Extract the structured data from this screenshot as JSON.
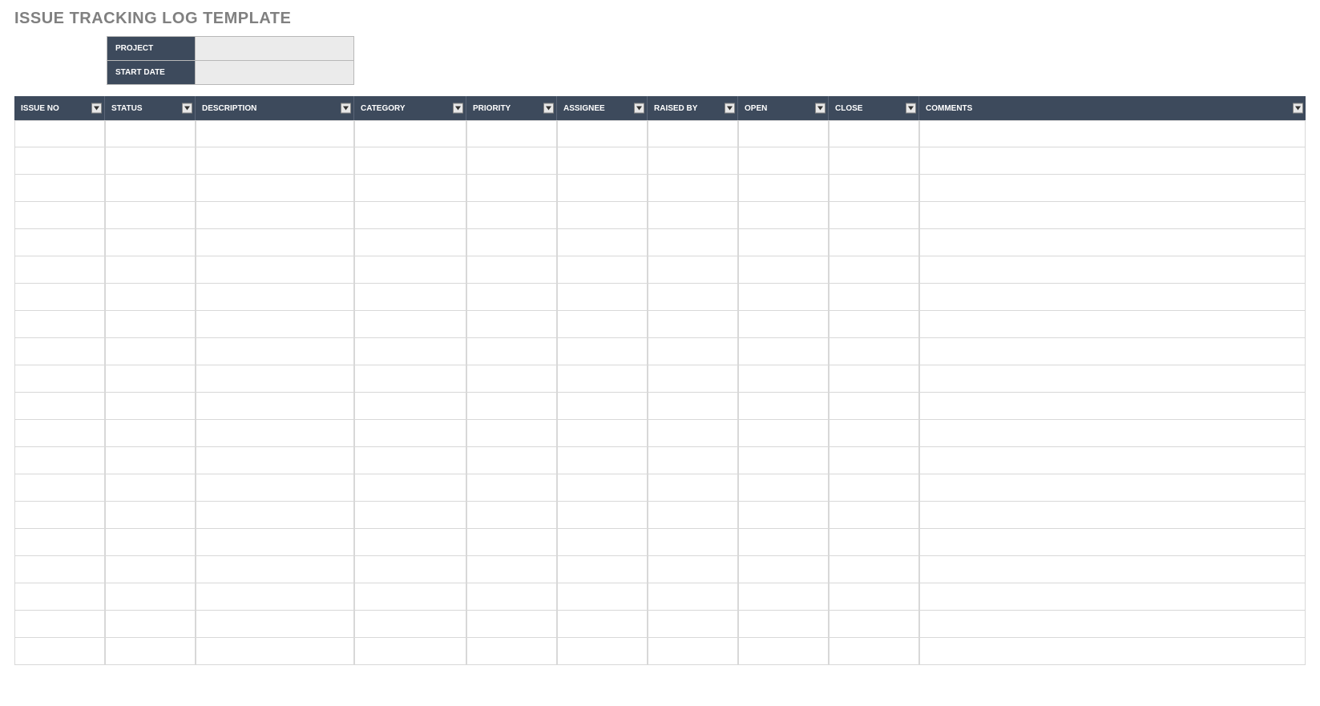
{
  "title": "ISSUE TRACKING LOG TEMPLATE",
  "meta": {
    "project_label": "PROJECT",
    "project_value": "",
    "start_date_label": "START DATE",
    "start_date_value": ""
  },
  "columns": [
    {
      "key": "issue_no",
      "label": "ISSUE NO"
    },
    {
      "key": "status",
      "label": "STATUS"
    },
    {
      "key": "description",
      "label": "DESCRIPTION"
    },
    {
      "key": "category",
      "label": "CATEGORY"
    },
    {
      "key": "priority",
      "label": "PRIORITY"
    },
    {
      "key": "assignee",
      "label": "ASSIGNEE"
    },
    {
      "key": "raised_by",
      "label": "RAISED BY"
    },
    {
      "key": "open",
      "label": "OPEN"
    },
    {
      "key": "close",
      "label": "CLOSE"
    },
    {
      "key": "comments",
      "label": "COMMENTS"
    }
  ],
  "rows": [
    {
      "issue_no": "",
      "status": "",
      "description": "",
      "category": "",
      "priority": "",
      "assignee": "",
      "raised_by": "",
      "open": "",
      "close": "",
      "comments": ""
    },
    {
      "issue_no": "",
      "status": "",
      "description": "",
      "category": "",
      "priority": "",
      "assignee": "",
      "raised_by": "",
      "open": "",
      "close": "",
      "comments": ""
    },
    {
      "issue_no": "",
      "status": "",
      "description": "",
      "category": "",
      "priority": "",
      "assignee": "",
      "raised_by": "",
      "open": "",
      "close": "",
      "comments": ""
    },
    {
      "issue_no": "",
      "status": "",
      "description": "",
      "category": "",
      "priority": "",
      "assignee": "",
      "raised_by": "",
      "open": "",
      "close": "",
      "comments": ""
    },
    {
      "issue_no": "",
      "status": "",
      "description": "",
      "category": "",
      "priority": "",
      "assignee": "",
      "raised_by": "",
      "open": "",
      "close": "",
      "comments": ""
    },
    {
      "issue_no": "",
      "status": "",
      "description": "",
      "category": "",
      "priority": "",
      "assignee": "",
      "raised_by": "",
      "open": "",
      "close": "",
      "comments": ""
    },
    {
      "issue_no": "",
      "status": "",
      "description": "",
      "category": "",
      "priority": "",
      "assignee": "",
      "raised_by": "",
      "open": "",
      "close": "",
      "comments": ""
    },
    {
      "issue_no": "",
      "status": "",
      "description": "",
      "category": "",
      "priority": "",
      "assignee": "",
      "raised_by": "",
      "open": "",
      "close": "",
      "comments": ""
    },
    {
      "issue_no": "",
      "status": "",
      "description": "",
      "category": "",
      "priority": "",
      "assignee": "",
      "raised_by": "",
      "open": "",
      "close": "",
      "comments": ""
    },
    {
      "issue_no": "",
      "status": "",
      "description": "",
      "category": "",
      "priority": "",
      "assignee": "",
      "raised_by": "",
      "open": "",
      "close": "",
      "comments": ""
    },
    {
      "issue_no": "",
      "status": "",
      "description": "",
      "category": "",
      "priority": "",
      "assignee": "",
      "raised_by": "",
      "open": "",
      "close": "",
      "comments": ""
    },
    {
      "issue_no": "",
      "status": "",
      "description": "",
      "category": "",
      "priority": "",
      "assignee": "",
      "raised_by": "",
      "open": "",
      "close": "",
      "comments": ""
    },
    {
      "issue_no": "",
      "status": "",
      "description": "",
      "category": "",
      "priority": "",
      "assignee": "",
      "raised_by": "",
      "open": "",
      "close": "",
      "comments": ""
    },
    {
      "issue_no": "",
      "status": "",
      "description": "",
      "category": "",
      "priority": "",
      "assignee": "",
      "raised_by": "",
      "open": "",
      "close": "",
      "comments": ""
    },
    {
      "issue_no": "",
      "status": "",
      "description": "",
      "category": "",
      "priority": "",
      "assignee": "",
      "raised_by": "",
      "open": "",
      "close": "",
      "comments": ""
    },
    {
      "issue_no": "",
      "status": "",
      "description": "",
      "category": "",
      "priority": "",
      "assignee": "",
      "raised_by": "",
      "open": "",
      "close": "",
      "comments": ""
    },
    {
      "issue_no": "",
      "status": "",
      "description": "",
      "category": "",
      "priority": "",
      "assignee": "",
      "raised_by": "",
      "open": "",
      "close": "",
      "comments": ""
    },
    {
      "issue_no": "",
      "status": "",
      "description": "",
      "category": "",
      "priority": "",
      "assignee": "",
      "raised_by": "",
      "open": "",
      "close": "",
      "comments": ""
    },
    {
      "issue_no": "",
      "status": "",
      "description": "",
      "category": "",
      "priority": "",
      "assignee": "",
      "raised_by": "",
      "open": "",
      "close": "",
      "comments": ""
    },
    {
      "issue_no": "",
      "status": "",
      "description": "",
      "category": "",
      "priority": "",
      "assignee": "",
      "raised_by": "",
      "open": "",
      "close": "",
      "comments": ""
    }
  ],
  "colors": {
    "header_bg": "#3d4a5c",
    "title_color": "#808080",
    "meta_value_bg": "#ebebeb",
    "cell_border": "#d8d8d8"
  }
}
